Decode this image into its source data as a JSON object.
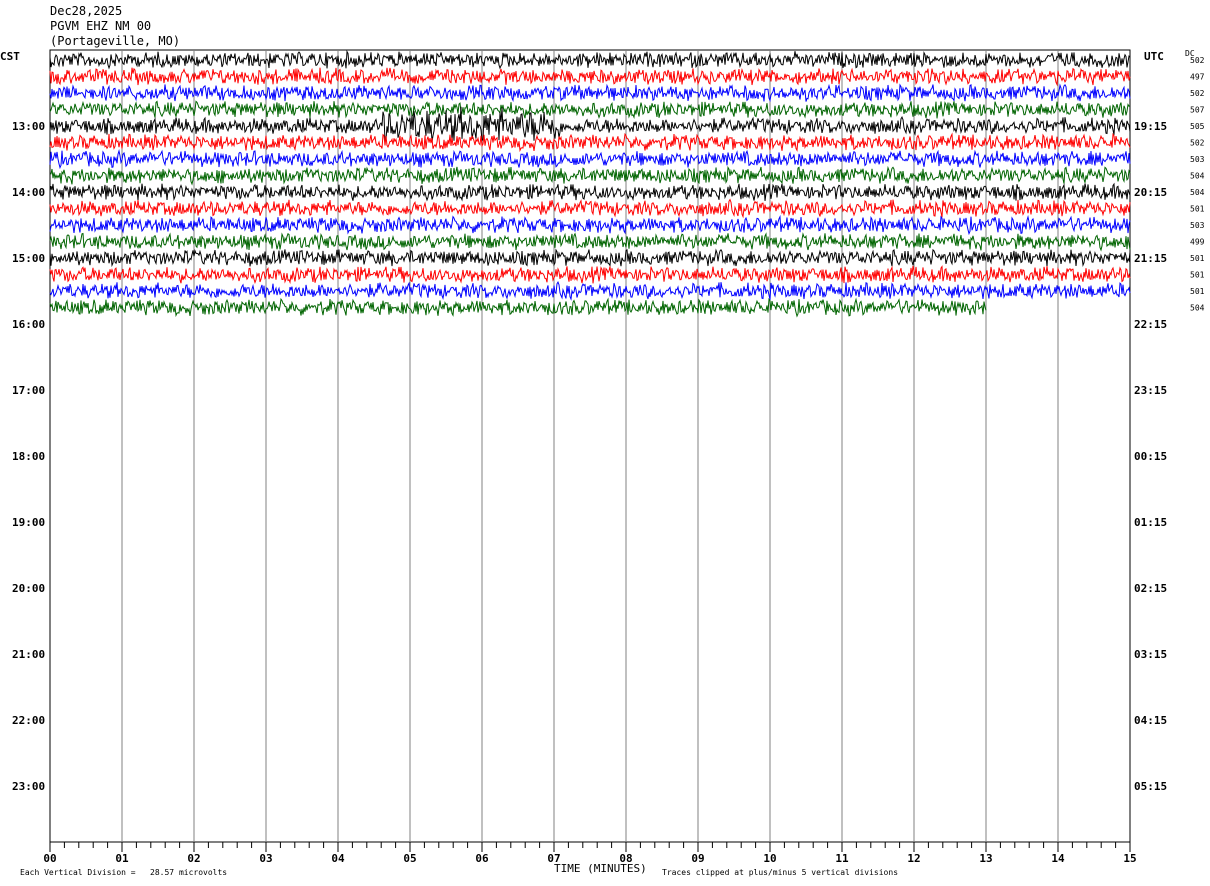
{
  "header": {
    "date": "Dec28,2025",
    "station": "PGVM EHZ NM 00",
    "location": "(Portageville, MO)"
  },
  "left_zone_label": "CST",
  "right_zone_label": "UTC",
  "dc_label": "DC",
  "footer": {
    "scale_note": "Each Vertical Division =   28.57 microvolts",
    "x_axis_label": "TIME (MINUTES)",
    "clip_note": "Traces clipped at plus/minus 5 vertical divisions"
  },
  "chart_data": {
    "type": "line",
    "title": "PGVM EHZ NM 00",
    "xlabel": "TIME (MINUTES)",
    "ylabel": "",
    "xlim": [
      0,
      15
    ],
    "x_ticks": [
      "00",
      "01",
      "02",
      "03",
      "04",
      "05",
      "06",
      "07",
      "08",
      "09",
      "10",
      "11",
      "12",
      "13",
      "14",
      "15"
    ],
    "left_time_labels": [
      "13:00",
      "14:00",
      "15:00",
      "16:00",
      "17:00",
      "18:00",
      "19:00",
      "20:00",
      "21:00",
      "22:00",
      "23:00"
    ],
    "right_time_labels": [
      "19:15",
      "20:15",
      "21:15",
      "22:15",
      "23:15",
      "00:15",
      "01:15",
      "02:15",
      "03:15",
      "04:15",
      "05:15"
    ],
    "trace_colors": [
      "#000000",
      "#ff0000",
      "#0000ff",
      "#006400"
    ],
    "traces": [
      {
        "color": "#000000",
        "dc": "502",
        "end_minute": 15
      },
      {
        "color": "#ff0000",
        "dc": "497",
        "end_minute": 15
      },
      {
        "color": "#0000ff",
        "dc": "502",
        "end_minute": 15
      },
      {
        "color": "#006400",
        "dc": "507",
        "end_minute": 15
      },
      {
        "color": "#000000",
        "dc": "505",
        "end_minute": 15
      },
      {
        "color": "#ff0000",
        "dc": "502",
        "end_minute": 15
      },
      {
        "color": "#0000ff",
        "dc": "503",
        "end_minute": 15
      },
      {
        "color": "#006400",
        "dc": "504",
        "end_minute": 15
      },
      {
        "color": "#000000",
        "dc": "504",
        "end_minute": 15
      },
      {
        "color": "#ff0000",
        "dc": "501",
        "end_minute": 15
      },
      {
        "color": "#0000ff",
        "dc": "503",
        "end_minute": 15
      },
      {
        "color": "#006400",
        "dc": "499",
        "end_minute": 15
      },
      {
        "color": "#000000",
        "dc": "501",
        "end_minute": 15
      },
      {
        "color": "#ff0000",
        "dc": "501",
        "end_minute": 15
      },
      {
        "color": "#0000ff",
        "dc": "501",
        "end_minute": 15
      },
      {
        "color": "#006400",
        "dc": "504",
        "end_minute": 13
      }
    ],
    "clip_divisions": 5,
    "vertical_division_microvolts": 28.57
  }
}
